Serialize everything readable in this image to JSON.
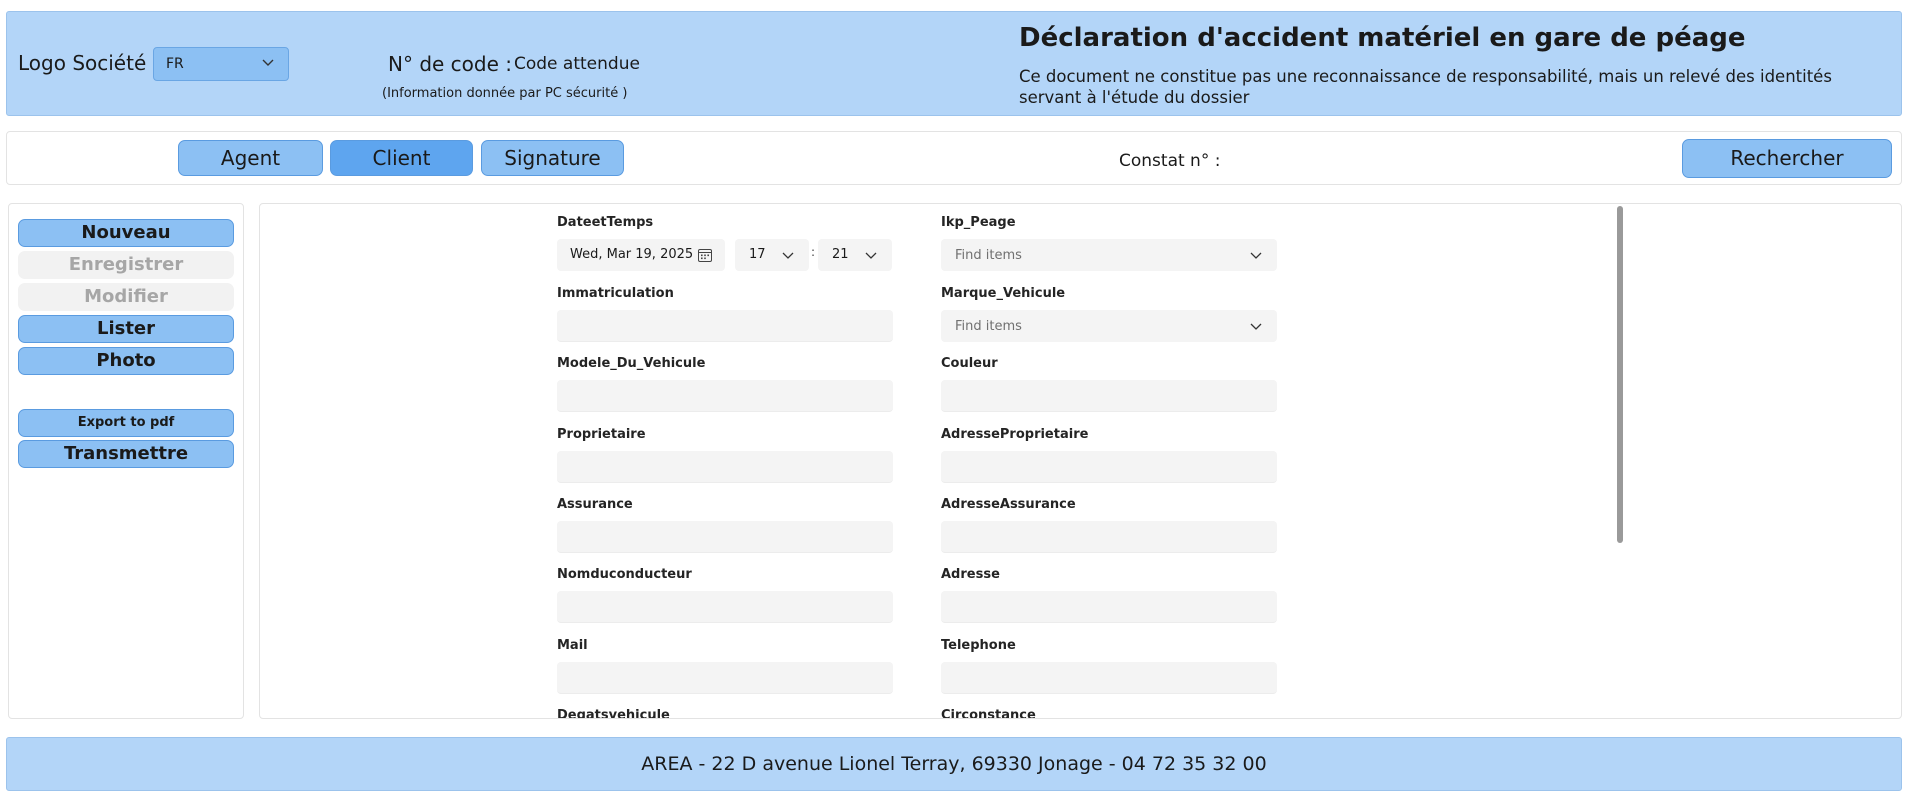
{
  "header": {
    "logo_text": "Logo Société",
    "language": "FR",
    "code_label": "N° de code :",
    "code_value": "Code attendue",
    "code_info": "(Information donnée par PC sécurité )",
    "title": "Déclaration d'accident matériel en gare de péage",
    "description": "Ce document ne constitue pas une reconnaissance de responsabilité, mais un relevé des identités servant à l'étude du dossier"
  },
  "tabs": {
    "agent": "Agent",
    "client": "Client",
    "signature": "Signature",
    "active": "Client"
  },
  "constat_label": "Constat n° :",
  "search_label": "Rechercher",
  "sidebar": {
    "nouveau": "Nouveau",
    "enregistrer": "Enregistrer",
    "modifier": "Modifier",
    "lister": "Lister",
    "photo": "Photo",
    "export_pdf": "Export to pdf",
    "transmettre": "Transmettre"
  },
  "form": {
    "datetime": {
      "label": "DateetTemps",
      "date": "Wed, Mar 19, 2025",
      "hour": "17",
      "minute": "21"
    },
    "peage": {
      "label": "Ikp_Peage",
      "placeholder": "Find items"
    },
    "immatriculation": {
      "label": "Immatriculation",
      "value": ""
    },
    "marque": {
      "label": "Marque_Vehicule",
      "placeholder": "Find items"
    },
    "modele": {
      "label": "Modele_Du_Vehicule",
      "value": ""
    },
    "couleur": {
      "label": "Couleur",
      "value": ""
    },
    "proprietaire": {
      "label": "Proprietaire",
      "value": ""
    },
    "adresse_proprietaire": {
      "label": "AdresseProprietaire",
      "value": ""
    },
    "assurance": {
      "label": "Assurance",
      "value": ""
    },
    "adresse_assurance": {
      "label": "AdresseAssurance",
      "value": ""
    },
    "nom_conducteur": {
      "label": "Nomduconducteur",
      "value": ""
    },
    "adresse": {
      "label": "Adresse",
      "value": ""
    },
    "mail": {
      "label": "Mail",
      "value": ""
    },
    "telephone": {
      "label": "Telephone",
      "value": ""
    },
    "degats": {
      "label": "Degatsvehicule"
    },
    "circonstance": {
      "label": "Circonstance"
    }
  },
  "footer": {
    "text": "AREA - 22 D avenue Lionel Terray, 69330 Jonage - 04 72 35 32 00"
  },
  "colors": {
    "header_bg": "#b3d5f8",
    "button_bg": "#8cc0f3",
    "button_active_bg": "#5ea5ef",
    "button_border": "#5a9be0",
    "input_bg": "#f4f4f4",
    "disabled_text": "#a6a6a6"
  },
  "icons": {
    "language_dropdown": "chevron-down-icon",
    "date_picker": "calendar-icon",
    "combo_dropdown": "chevron-down-icon"
  }
}
